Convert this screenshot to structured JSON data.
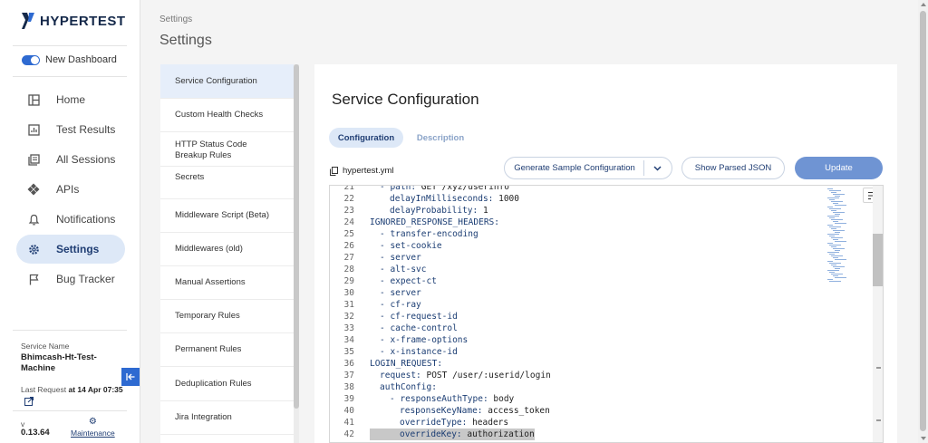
{
  "brand": {
    "name": "HYPERTEST",
    "color": "#15294a",
    "accent": "#2e6ad1"
  },
  "dashboard_toggle": {
    "label": "New Dashboard",
    "on": true
  },
  "nav": [
    {
      "label": "Home",
      "icon": "layout-icon",
      "active": false
    },
    {
      "label": "Test Results",
      "icon": "chart-icon",
      "active": false
    },
    {
      "label": "All Sessions",
      "icon": "sessions-icon",
      "active": false
    },
    {
      "label": "APIs",
      "icon": "api-icon",
      "active": false
    },
    {
      "label": "Notifications",
      "icon": "bell-icon",
      "active": false
    },
    {
      "label": "Settings",
      "icon": "gear-icon",
      "active": true
    },
    {
      "label": "Bug Tracker",
      "icon": "flag-icon",
      "active": false
    }
  ],
  "service": {
    "label": "Service Name",
    "name": "Bhimcash-Ht-Test-Machine",
    "last_request_label": "Last Request",
    "last_request_value": "at 14 Apr 07:35",
    "version_label": "v",
    "version": "0.13.64",
    "maintenance_label": "Maintenance"
  },
  "header": {
    "breadcrumb": "Settings",
    "title": "Settings"
  },
  "settings_menu": [
    {
      "label": "Service Configuration",
      "active": true
    },
    {
      "label": "Custom Health Checks",
      "active": false
    },
    {
      "label": "HTTP Status Code Breakup Rules",
      "active": false
    },
    {
      "label": "Secrets",
      "active": false
    },
    {
      "label": "Middleware Script (Beta)",
      "active": false
    },
    {
      "label": "Middlewares (old)",
      "active": false
    },
    {
      "label": "Manual Assertions",
      "active": false
    },
    {
      "label": "Temporary Rules",
      "active": false
    },
    {
      "label": "Permanent Rules",
      "active": false
    },
    {
      "label": "Deduplication Rules",
      "active": false
    },
    {
      "label": "Jira Integration",
      "active": false
    }
  ],
  "main": {
    "title": "Service Configuration",
    "tabs": [
      {
        "label": "Configuration",
        "active": true
      },
      {
        "label": "Description",
        "active": false
      }
    ],
    "file_name": "hypertest.yml",
    "generate_label": "Generate Sample Configuration",
    "parsed_label": "Show Parsed JSON",
    "update_label": "Update"
  },
  "editor_lines": [
    {
      "n": "21",
      "indent": 1,
      "text": "- path: GET /xyz/userinfo",
      "highlight": false
    },
    {
      "n": "22",
      "indent": 2,
      "text": "delayInMilliseconds: 1000",
      "highlight": false
    },
    {
      "n": "23",
      "indent": 2,
      "text": "delayProbability: 1",
      "highlight": false
    },
    {
      "n": "24",
      "indent": 0,
      "text": "IGNORED_RESPONSE_HEADERS:",
      "highlight": false
    },
    {
      "n": "25",
      "indent": 1,
      "text": "- transfer-encoding",
      "highlight": false
    },
    {
      "n": "26",
      "indent": 1,
      "text": "- set-cookie",
      "highlight": false
    },
    {
      "n": "27",
      "indent": 1,
      "text": "- server",
      "highlight": false
    },
    {
      "n": "28",
      "indent": 1,
      "text": "- alt-svc",
      "highlight": false
    },
    {
      "n": "29",
      "indent": 1,
      "text": "- expect-ct",
      "highlight": false
    },
    {
      "n": "30",
      "indent": 1,
      "text": "- server",
      "highlight": false
    },
    {
      "n": "31",
      "indent": 1,
      "text": "- cf-ray",
      "highlight": false
    },
    {
      "n": "32",
      "indent": 1,
      "text": "- cf-request-id",
      "highlight": false
    },
    {
      "n": "33",
      "indent": 1,
      "text": "- cache-control",
      "highlight": false
    },
    {
      "n": "34",
      "indent": 1,
      "text": "- x-frame-options",
      "highlight": false
    },
    {
      "n": "35",
      "indent": 1,
      "text": "- x-instance-id",
      "highlight": false
    },
    {
      "n": "36",
      "indent": 0,
      "text": "LOGIN_REQUEST:",
      "highlight": false
    },
    {
      "n": "37",
      "indent": 1,
      "text": "request: POST /user/:userid/login",
      "highlight": false
    },
    {
      "n": "38",
      "indent": 1,
      "text": "authConfig:",
      "highlight": false
    },
    {
      "n": "39",
      "indent": 2,
      "text": "- responseAuthType: body",
      "highlight": false
    },
    {
      "n": "40",
      "indent": 3,
      "text": "responseKeyName: access_token",
      "highlight": false
    },
    {
      "n": "41",
      "indent": 3,
      "text": "overrideType: headers",
      "highlight": false
    },
    {
      "n": "42",
      "indent": 3,
      "text": "overrideKey: authorization",
      "highlight": true
    }
  ]
}
